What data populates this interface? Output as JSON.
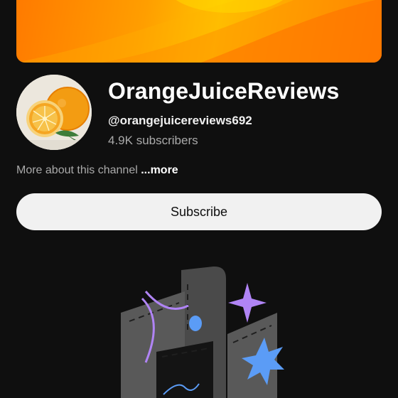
{
  "channel": {
    "name": "OrangeJuiceReviews",
    "handle": "@orangejuicereviews692",
    "subscribers": "4.9K subscribers",
    "about_text": "More about this channel",
    "about_more": "...more"
  },
  "actions": {
    "subscribe_label": "Subscribe"
  },
  "colors": {
    "background": "#0f0f0f",
    "banner_orange": "#ff7a00",
    "banner_yellow": "#ffc300",
    "subscribe_bg": "#f1f1f1",
    "illustration_purple": "#b084f5",
    "illustration_blue": "#5b9cf6"
  },
  "icons": {
    "avatar": "orange-fruit-avatar",
    "illustration": "empty-channel-illustration"
  }
}
